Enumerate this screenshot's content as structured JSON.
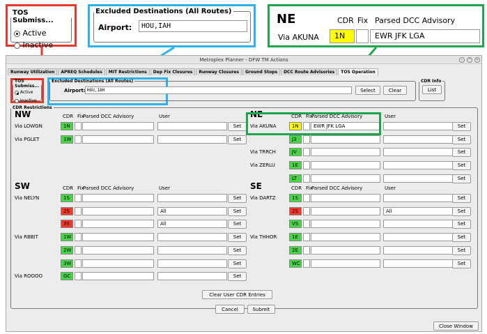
{
  "colors": {
    "green": "#47d447",
    "red": "#f23a2a",
    "yellow": "#ffff00",
    "callout_red": "#e53a2b",
    "callout_blue": "#2bb3f0",
    "callout_green": "#1fa64a"
  },
  "zoom_tos": {
    "legend": "TOS Submiss...",
    "active": "Active",
    "inactive": "Inactive"
  },
  "zoom_excluded": {
    "legend": "Excluded Destinations (All Routes)",
    "airport_label": "Airport:",
    "airport_value": "HOU,IAH"
  },
  "zoom_ne": {
    "title": "NE",
    "cdr": "CDR",
    "fix": "Fix",
    "parsed": "Parsed DCC Advisory",
    "via": "Via AKUNA",
    "code": "1N",
    "advisory": "EWR JFK LGA"
  },
  "window": {
    "title": "Metroplex Planner - DFW TM Actions"
  },
  "tabs": [
    "Runway Utilization",
    "APREQ Schedules",
    "MIT Restrictions",
    "Dep Fix Closures",
    "Runway Closures",
    "Ground Stops",
    "DCC Route Advisories",
    "TOS Operation"
  ],
  "tos": {
    "legend": "TOS Submiss...",
    "active": "Active",
    "inactive": "Inactive"
  },
  "excluded": {
    "legend": "Excluded Destinations (All Routes)",
    "airport_label": "Airport:",
    "airport_value": "HOU,IAH",
    "select": "Select",
    "clear": "Clear"
  },
  "cdrinfo": {
    "legend": "CDR Info",
    "list": "List"
  },
  "cdr_restrictions": "CDR Restrictions",
  "col": {
    "cdr": "CDR",
    "fix": "Fix",
    "parsed": "Parsed DCC Advisory",
    "user": "User",
    "set": "Set"
  },
  "nw": {
    "title": "NW",
    "rows": [
      {
        "via": "Via LOWGN",
        "code": "1N",
        "color": "green",
        "advisory": "",
        "user": ""
      },
      {
        "via": "Via PGLET",
        "code": "1W",
        "color": "green",
        "advisory": "",
        "user": ""
      }
    ]
  },
  "ne": {
    "title": "NE",
    "rows": [
      {
        "via": "Via AKUNA",
        "code": "1N",
        "color": "yellow",
        "advisory": "EWR JFK LGA",
        "user": ""
      },
      {
        "via": "",
        "code": "J3",
        "color": "green",
        "advisory": "",
        "user": ""
      },
      {
        "via": "Via TRRCH",
        "code": "JV",
        "color": "green",
        "advisory": "",
        "user": ""
      },
      {
        "via": "Via ZERLU",
        "code": "1E",
        "color": "green",
        "advisory": "",
        "user": ""
      },
      {
        "via": "",
        "code": "LT",
        "color": "green",
        "advisory": "",
        "user": ""
      }
    ]
  },
  "sw": {
    "title": "SW",
    "rows": [
      {
        "via": "Via NELYN",
        "code": "1S",
        "color": "green",
        "advisory": "",
        "user": ""
      },
      {
        "via": "",
        "code": "2S",
        "color": "red",
        "advisory": "",
        "user": "All"
      },
      {
        "via": "",
        "code": "3S",
        "color": "red",
        "advisory": "",
        "user": "All"
      },
      {
        "via": "Via RBBIT",
        "code": "1W",
        "color": "green",
        "advisory": "",
        "user": ""
      },
      {
        "via": "",
        "code": "2W",
        "color": "green",
        "advisory": "",
        "user": ""
      },
      {
        "via": "",
        "code": "3W",
        "color": "green",
        "advisory": "",
        "user": ""
      },
      {
        "via": "Via ROOOO",
        "code": "GC",
        "color": "green",
        "advisory": "",
        "user": ""
      }
    ]
  },
  "se": {
    "title": "SE",
    "rows": [
      {
        "via": "Via DARTZ",
        "code": "1S",
        "color": "green",
        "advisory": "",
        "user": ""
      },
      {
        "via": "",
        "code": "2S",
        "color": "red",
        "advisory": "",
        "user": "All"
      },
      {
        "via": "",
        "code": "VS",
        "color": "green",
        "advisory": "",
        "user": ""
      },
      {
        "via": "Via THHOR",
        "code": "1E",
        "color": "green",
        "advisory": "",
        "user": ""
      },
      {
        "via": "",
        "code": "2E",
        "color": "green",
        "advisory": "",
        "user": ""
      },
      {
        "via": "",
        "code": "WC",
        "color": "green",
        "advisory": "",
        "user": ""
      }
    ]
  },
  "buttons": {
    "clear_user": "Clear User CDR Entries",
    "cancel": "Cancel",
    "submit": "Submit",
    "close": "Close Window"
  }
}
